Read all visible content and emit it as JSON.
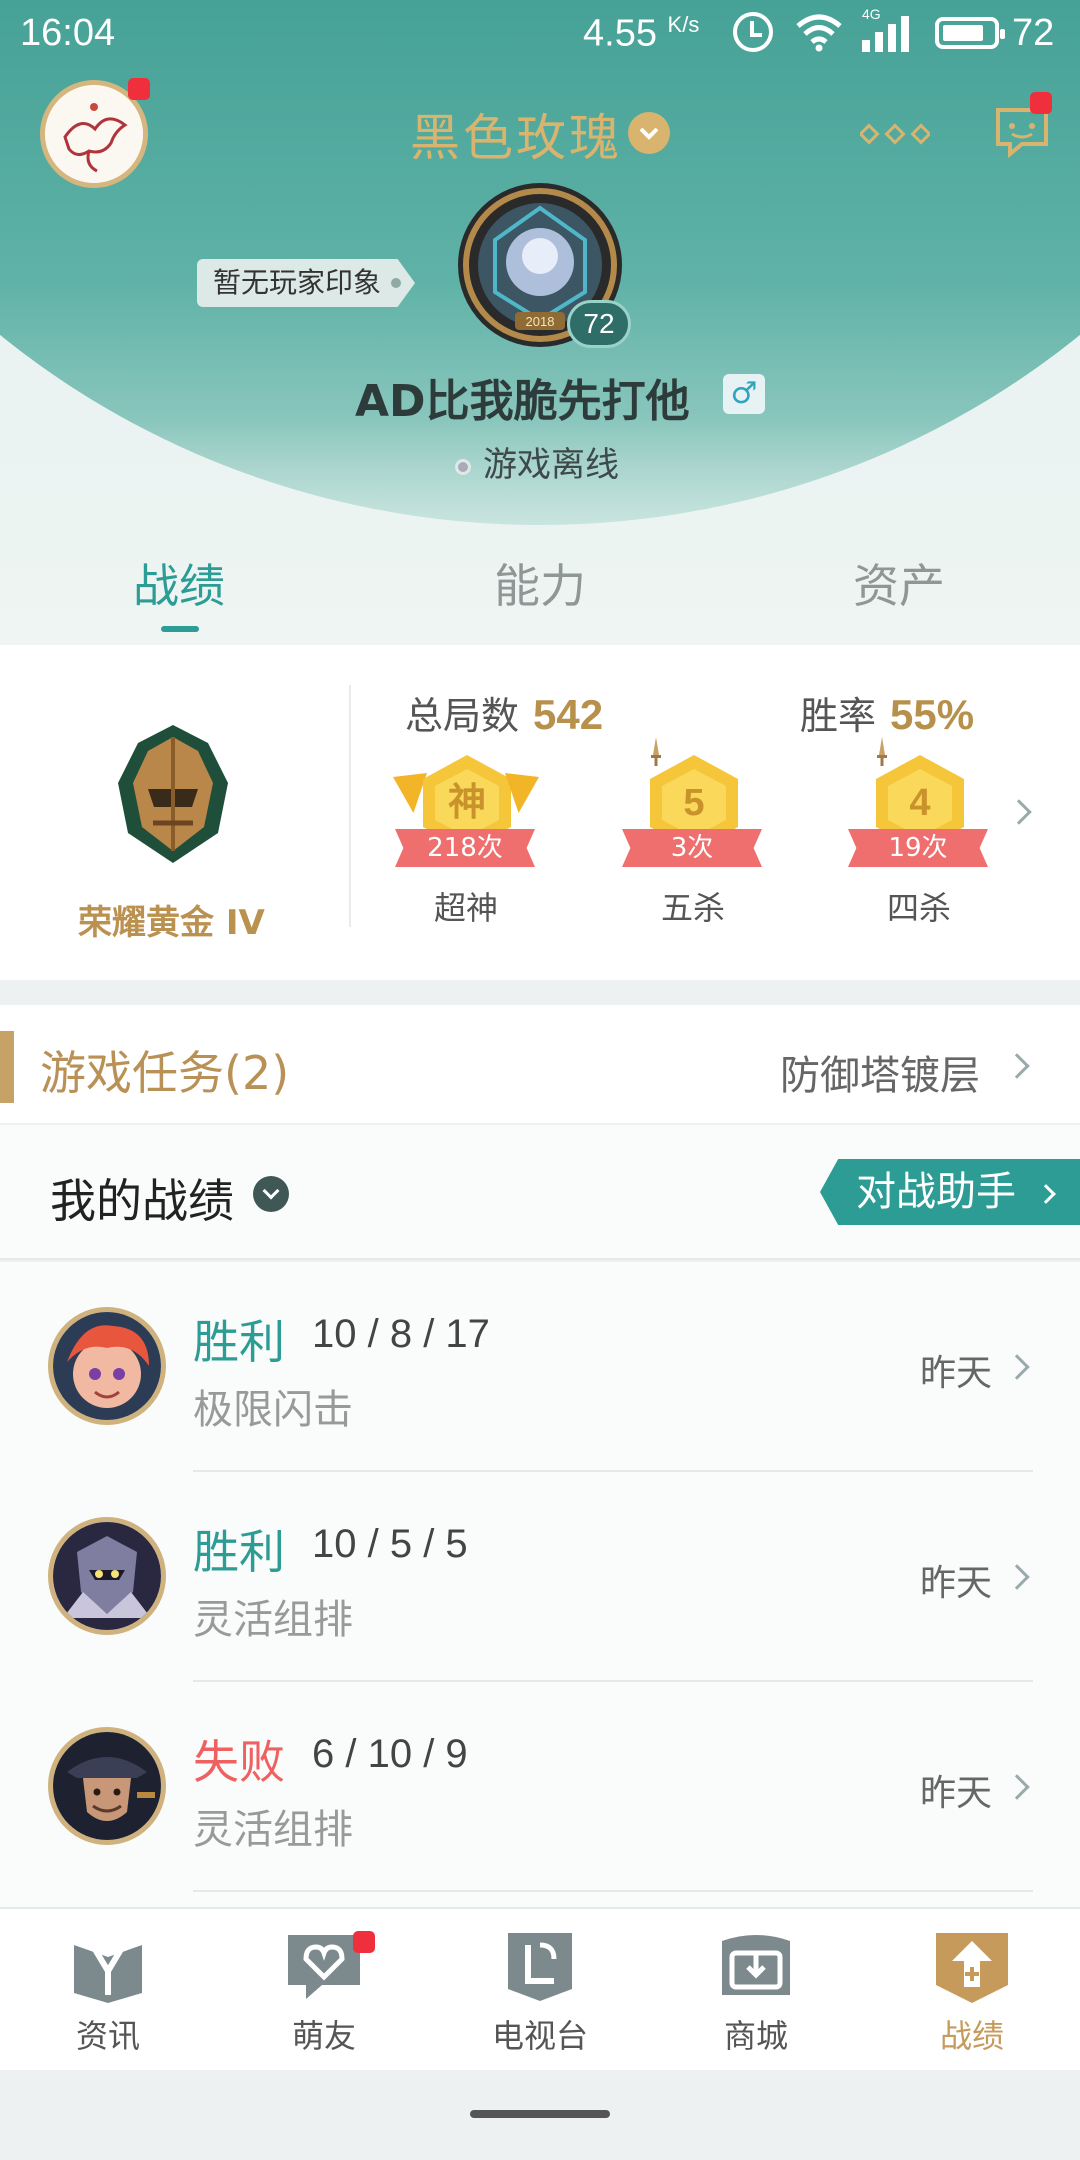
{
  "status_bar": {
    "time": "16:04",
    "speed": "4.55",
    "speed_unit": "K/s",
    "network": "4G",
    "battery": "72"
  },
  "header": {
    "nickname": "黑色玫瑰",
    "impression_tag": "暂无玩家印象",
    "level": "72",
    "player_name": "AD比我脆先打他",
    "gender_symbol": "♂",
    "status": "游戏离线",
    "medal_year": "2018"
  },
  "tabs": [
    {
      "label": "战绩",
      "active": true
    },
    {
      "label": "能力",
      "active": false
    },
    {
      "label": "资产",
      "active": false
    }
  ],
  "stats": {
    "rank_name": "荣耀黄金 IV",
    "total_games_label": "总局数",
    "total_games": "542",
    "win_rate_label": "胜率",
    "win_rate": "55%",
    "honors": [
      {
        "glyph": "神",
        "count": "218次",
        "label": "超神"
      },
      {
        "glyph": "5",
        "count": "3次",
        "label": "五杀"
      },
      {
        "glyph": "4",
        "count": "19次",
        "label": "四杀"
      }
    ]
  },
  "tasks": {
    "title": "游戏任务(2)",
    "right_label": "防御塔镀层"
  },
  "my_record": {
    "title": "我的战绩",
    "assistant_button": "对战助手"
  },
  "matches": [
    {
      "result": "胜利",
      "outcome": "win",
      "kda": "10 / 8 / 17",
      "mode": "极限闪击",
      "time": "昨天"
    },
    {
      "result": "胜利",
      "outcome": "win",
      "kda": "10 / 5 / 5",
      "mode": "灵活组排",
      "time": "昨天"
    },
    {
      "result": "失败",
      "outcome": "loss",
      "kda": "6 / 10 / 9",
      "mode": "灵活组排",
      "time": "昨天"
    }
  ],
  "bottom_nav": [
    {
      "label": "资讯",
      "icon": "news-icon",
      "active": false
    },
    {
      "label": "萌友",
      "icon": "friends-icon",
      "active": false,
      "badge": true
    },
    {
      "label": "电视台",
      "icon": "tv-icon",
      "active": false
    },
    {
      "label": "商城",
      "icon": "shop-icon",
      "active": false
    },
    {
      "label": "战绩",
      "icon": "record-icon",
      "active": true
    }
  ],
  "colors": {
    "primary": "#2c9c95",
    "gold": "#c59a5b",
    "loss": "#ef6161",
    "header_bg": "#3b9a8f"
  }
}
